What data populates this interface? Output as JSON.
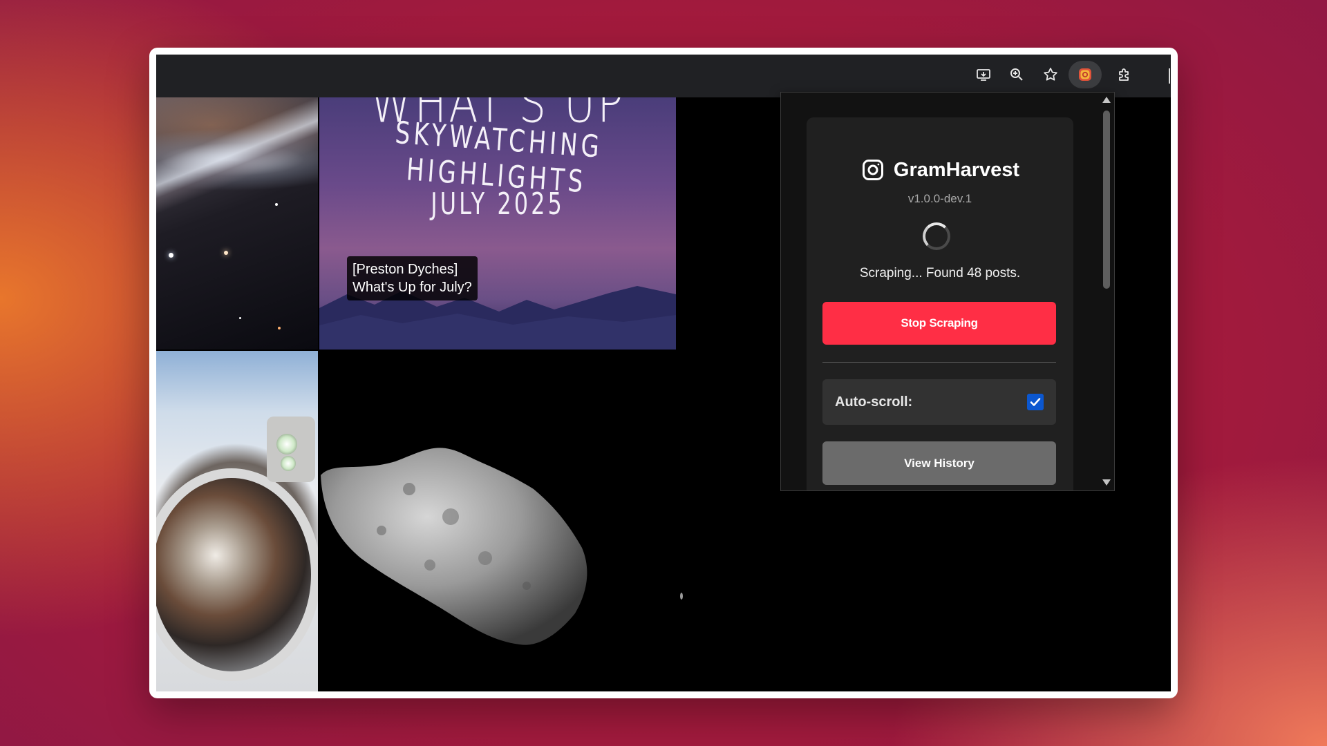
{
  "toolbar": {
    "icons": [
      "install-app-icon",
      "zoom-icon",
      "bookmark-star-icon",
      "gramharvest-extension-icon",
      "extensions-puzzle-icon"
    ]
  },
  "feed": {
    "skywatch": {
      "title_top": "WHAT'S UP",
      "subtitle": "SKYWATCHING HIGHLIGHTS",
      "date": "JULY 2025",
      "caption_line1": "[Preston Dyches]",
      "caption_line2": "What's Up for July?"
    }
  },
  "popup": {
    "app_name": "GramHarvest",
    "version": "v1.0.0-dev.1",
    "status": "Scraping... Found 48 posts.",
    "stop_label": "Stop Scraping",
    "auto_scroll_label": "Auto-scroll:",
    "auto_scroll_checked": true,
    "history_label": "View History",
    "colors": {
      "stop_button": "#ff2e45",
      "history_button": "#6b6b6b",
      "checkbox": "#0b57d0"
    }
  }
}
